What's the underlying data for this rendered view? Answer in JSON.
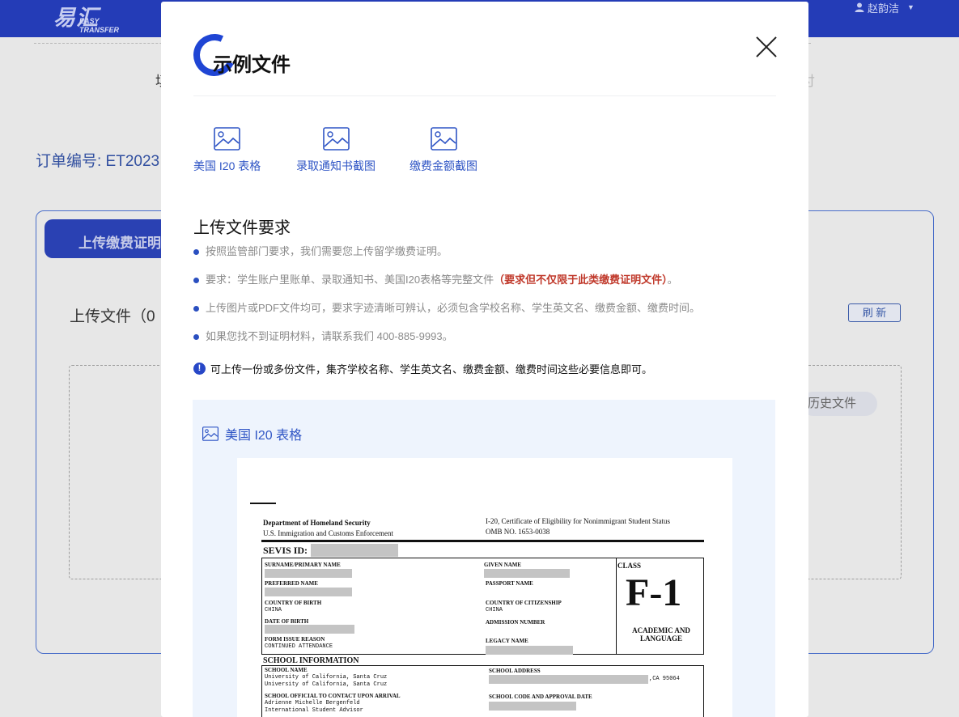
{
  "app": {
    "logo_text": "易汇",
    "logo_subtext": "EASY TRANSFER",
    "user_name": "赵韵洁"
  },
  "background": {
    "bg_left_char": "填",
    "bg_right_char": "付",
    "order_label": "订单编号: ET2023",
    "tab_label": "上传缴费证明",
    "upload_title": "上传文件（0",
    "refresh_label": "刷 新",
    "history_label": "历史文件"
  },
  "modal": {
    "title": "示例文件",
    "samples": [
      {
        "label": "美国 I20 表格",
        "icon": "image-icon"
      },
      {
        "label": "录取通知书截图",
        "icon": "image-icon"
      },
      {
        "label": "缴费金额截图",
        "icon": "image-icon"
      }
    ],
    "requirements_title": "上传文件要求",
    "requirements": [
      {
        "text": "按照监管部门要求，我们需要您上传留学缴费证明。"
      },
      {
        "text": "要求：学生账户里账单、录取通知书、美国I20表格等完整文件",
        "highlight": "（要求但不仅限于此类缴费证明文件）",
        "tail": "。"
      },
      {
        "text": "上传图片或PDF文件均可，要求字迹清晰可辨认，必须包含学校名称、学生英文名、缴费金额、缴费时间。"
      },
      {
        "text": "如果您找不到证明材料，请联系我们 400-885-9993。"
      }
    ],
    "notice": "可上传一份或多份文件，集齐学校名称、学生英文名、缴费金额、缴费时间这些必要信息即可。",
    "preview_title": "美国 I20 表格",
    "document": {
      "dept": "Department of Homeland Security",
      "agency": "U.S. Immigration and Customs Enforcement",
      "form_title": "I-20, Certificate of Eligibility for Nonimmigrant Student Status",
      "omb": "OMB NO. 1653-0038",
      "sevis": "SEVIS ID:",
      "surname": "SURNAME/PRIMARY NAME",
      "given_name": "GIVEN NAME",
      "class_label": "CLASS",
      "class_value": "F-1",
      "class_desc": "ACADEMIC AND LANGUAGE",
      "preferred": "PREFERRED NAME",
      "passport": "PASSPORT NAME",
      "birth_country": "COUNTRY OF BIRTH",
      "birth_country_value": "CHINA",
      "citizenship": "COUNTRY OF CITIZENSHIP",
      "citizenship_value": "CHINA",
      "dob": "DATE OF BIRTH",
      "admission": "ADMISSION NUMBER",
      "issue_reason": "FORM ISSUE REASON",
      "issue_reason_value": "CONTINUED ATTENDANCE",
      "legacy": "LEGACY NAME",
      "school_info": "SCHOOL INFORMATION",
      "school_name": "SCHOOL NAME",
      "school_name_value": "University of California, Santa Cruz",
      "school_name_value2": "University of California, Santa Cruz",
      "school_address": "SCHOOL ADDRESS",
      "school_address_value": ",CA 95064",
      "official": "SCHOOL OFFICIAL TO CONTACT UPON ARRIVAL",
      "official_name": "Adrienne Michelle Bergenfeld",
      "official_title": "International Student Advisor",
      "school_code": "SCHOOL CODE AND APPROVAL DATE"
    }
  },
  "colors": {
    "topbar": "#243cb7",
    "accent": "#2f55c5",
    "highlight": "#c0392b"
  }
}
